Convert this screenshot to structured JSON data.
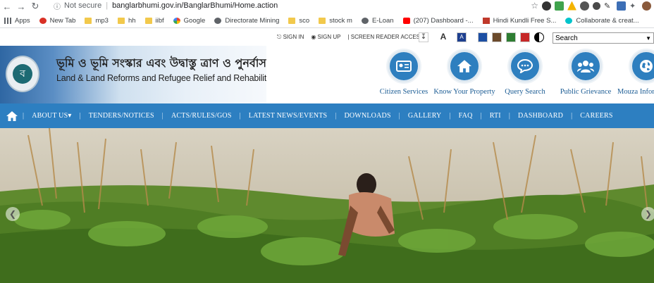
{
  "browser": {
    "insecure_label": "Not secure",
    "url": "banglarbhumi.gov.in/BanglarBhumi/Home.action"
  },
  "bookmarks": [
    {
      "label": "Apps",
      "icon": "apps-grid-icon"
    },
    {
      "label": "New Tab",
      "icon": "newtab-icon"
    },
    {
      "label": "mp3",
      "icon": "folder-icon"
    },
    {
      "label": "hh",
      "icon": "folder-icon"
    },
    {
      "label": "iibf",
      "icon": "folder-icon"
    },
    {
      "label": "Google",
      "icon": "google-icon"
    },
    {
      "label": "Directorate Mining",
      "icon": "globe-icon"
    },
    {
      "label": "sco",
      "icon": "folder-icon"
    },
    {
      "label": "stock m",
      "icon": "folder-icon"
    },
    {
      "label": "E-Loan",
      "icon": "globe-icon"
    },
    {
      "label": "(207) Dashboard -...",
      "icon": "youtube-icon"
    },
    {
      "label": "Hindi Kundli Free S...",
      "icon": "kundli-icon"
    },
    {
      "label": "Collaborate & creat...",
      "icon": "canva-icon"
    }
  ],
  "utility": {
    "sign_in": "SIGN IN",
    "sign_up": "SIGN UP",
    "screen_reader": "SCREEN READER ACCESS",
    "font_label": "A",
    "search_placeholder": "Search",
    "theme_colors": [
      "#1d4fa3",
      "#6b4a2b",
      "#2e7d32",
      "#c62828"
    ]
  },
  "header": {
    "bengali_title": "ভূমি ও ভূমি সংস্কার এবং উদ্বাস্তু ত্রাণ ও পুনর্বাসন দপ্তর",
    "english_title": "Land & Land Reforms and Refugee Relief and Rehabilitation Department",
    "services": [
      {
        "label": "Citizen Services",
        "icon": "id-card-icon"
      },
      {
        "label": "Know Your Property",
        "icon": "home-icon"
      },
      {
        "label": "Query Search",
        "icon": "chat-bubble-icon"
      },
      {
        "label": "Public Grievance",
        "icon": "people-icon"
      },
      {
        "label": "Mouza Information",
        "icon": "globe-icon"
      }
    ]
  },
  "menu": {
    "items": [
      "ABOUT US",
      "TENDERS/NOTICES",
      "ACTS/RULES/GOS",
      "LATEST NEWS/EVENTS",
      "DOWNLOADS",
      "GALLERY",
      "FAQ",
      "RTI",
      "DASHBOARD",
      "CAREERS"
    ]
  },
  "colors": {
    "menu_bg": "#2d7fc1",
    "service_circle": "#2e7fbf",
    "service_label": "#1b5c94"
  }
}
